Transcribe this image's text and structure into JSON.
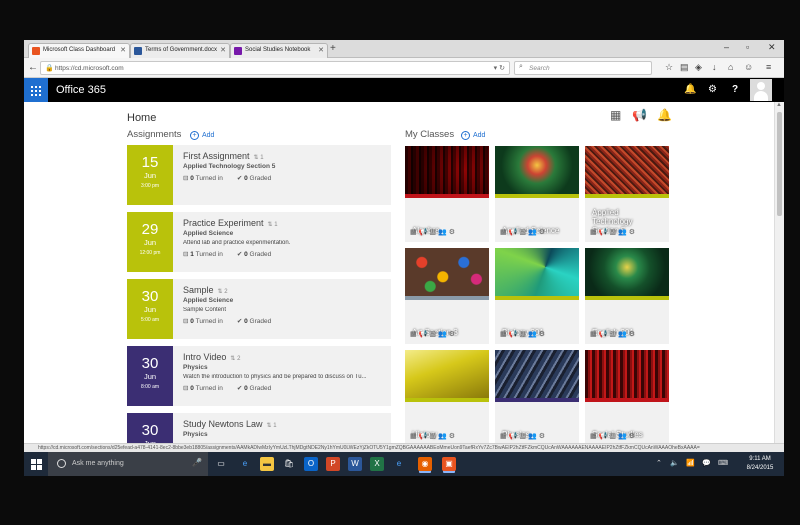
{
  "browser": {
    "tabs": [
      {
        "label": "Microsoft Class Dashboard",
        "active": true,
        "icon_color": "#e95420"
      },
      {
        "label": "Terms of Government.docx",
        "active": false,
        "icon_color": "#2b579a"
      },
      {
        "label": "Social Studies Notebook",
        "active": false,
        "icon_color": "#7719aa"
      }
    ],
    "new_tab": "+",
    "url": "https://cd.microsoft.com",
    "search_placeholder": "Search",
    "status_url": "https://cd.microsoft.com/sections/d25efead-a478-4141-8ec2-8bbe3eb18805/assignments/AAMkADIwMzIyYmUzLThjMDgtNDE2Ny1hYmU0LWEzYjZkOTU5Y1gmZQBGAAAAAABEoMmeUon9TaefRxYv7Zc7BwAEIP2hZtfFZkmCQUcAnWAAAAAAENAAAAEIP2hZtfFZkmCQUcAnWAAAOheBxAAAA="
  },
  "o365": {
    "title": "Office 365"
  },
  "page": {
    "home_label": "Home"
  },
  "assignments": {
    "title": "Assignments",
    "add_label": "Add",
    "turned_in_label": "Turned in",
    "graded_label": "Graded",
    "items": [
      {
        "day": "15",
        "month": "Jun",
        "time": "3:00 pm",
        "name": "First Assignment",
        "rank": "1",
        "class": "Applied Technology Section 5",
        "description": "",
        "turned_in": "0",
        "graded": "0",
        "color": "#b9c20b"
      },
      {
        "day": "29",
        "month": "Jun",
        "time": "12:00 pm",
        "name": "Practice Experiment",
        "rank": "1",
        "class": "Applied Science",
        "description": "Attend lab and practice experimentation.",
        "turned_in": "1",
        "graded": "0",
        "color": "#b9c20b"
      },
      {
        "day": "30",
        "month": "Jun",
        "time": "5:00 am",
        "name": "Sample",
        "rank": "2",
        "class": "Applied Science",
        "description": "Sample Content",
        "turned_in": "0",
        "graded": "0",
        "color": "#b9c20b"
      },
      {
        "day": "30",
        "month": "Jun",
        "time": "8:00 am",
        "name": "Intro Video",
        "rank": "2",
        "class": "Physics",
        "description": "Watch the introduction to physics and be prepared to discuss on Tu...",
        "turned_in": "0",
        "graded": "0",
        "color": "#3b2e73"
      },
      {
        "day": "30",
        "month": "Jun",
        "time": "",
        "name": "Study Newtons Law",
        "rank": "1",
        "class": "Physics",
        "description": "",
        "turned_in": "",
        "graded": "",
        "color": "#3b2e73"
      }
    ]
  },
  "classes": {
    "title": "My Classes",
    "add_label": "Add",
    "items": [
      {
        "name": "Algebra",
        "bar_color": "#c0141a",
        "img": "algebra"
      },
      {
        "name": "Applied Science",
        "bar_color": "#b9c20b",
        "img": "appsci"
      },
      {
        "name": "Applied Technology Section 5",
        "bar_color": "#b9c20b",
        "img": "apptech"
      },
      {
        "name": "Art Section 3",
        "bar_color": "#8a9aa8",
        "img": "art"
      },
      {
        "name": "Biology 301",
        "bar_color": "#b9c20b",
        "img": "bio"
      },
      {
        "name": "English 201",
        "bar_color": "#b9c20b",
        "img": "eng"
      },
      {
        "name": "History",
        "bar_color": "#b9c20b",
        "img": "hist"
      },
      {
        "name": "Physics",
        "bar_color": "#3b2e73",
        "img": "phys"
      },
      {
        "name": "Social Studies",
        "bar_color": "#c0141a",
        "img": "soc"
      }
    ]
  },
  "taskbar": {
    "search_placeholder": "Ask me anything",
    "time": "9:11 AM",
    "date": "8/24/2015"
  },
  "icons": [
    "back-icon",
    "lock-icon",
    "reload-icon",
    "star-icon",
    "library-icon",
    "pocket-icon",
    "download-icon",
    "home-icon",
    "chat-icon",
    "menu-icon",
    "bell-icon",
    "gear-icon",
    "help-icon",
    "notebook-icon",
    "megaphone-icon",
    "page-bell-icon"
  ]
}
